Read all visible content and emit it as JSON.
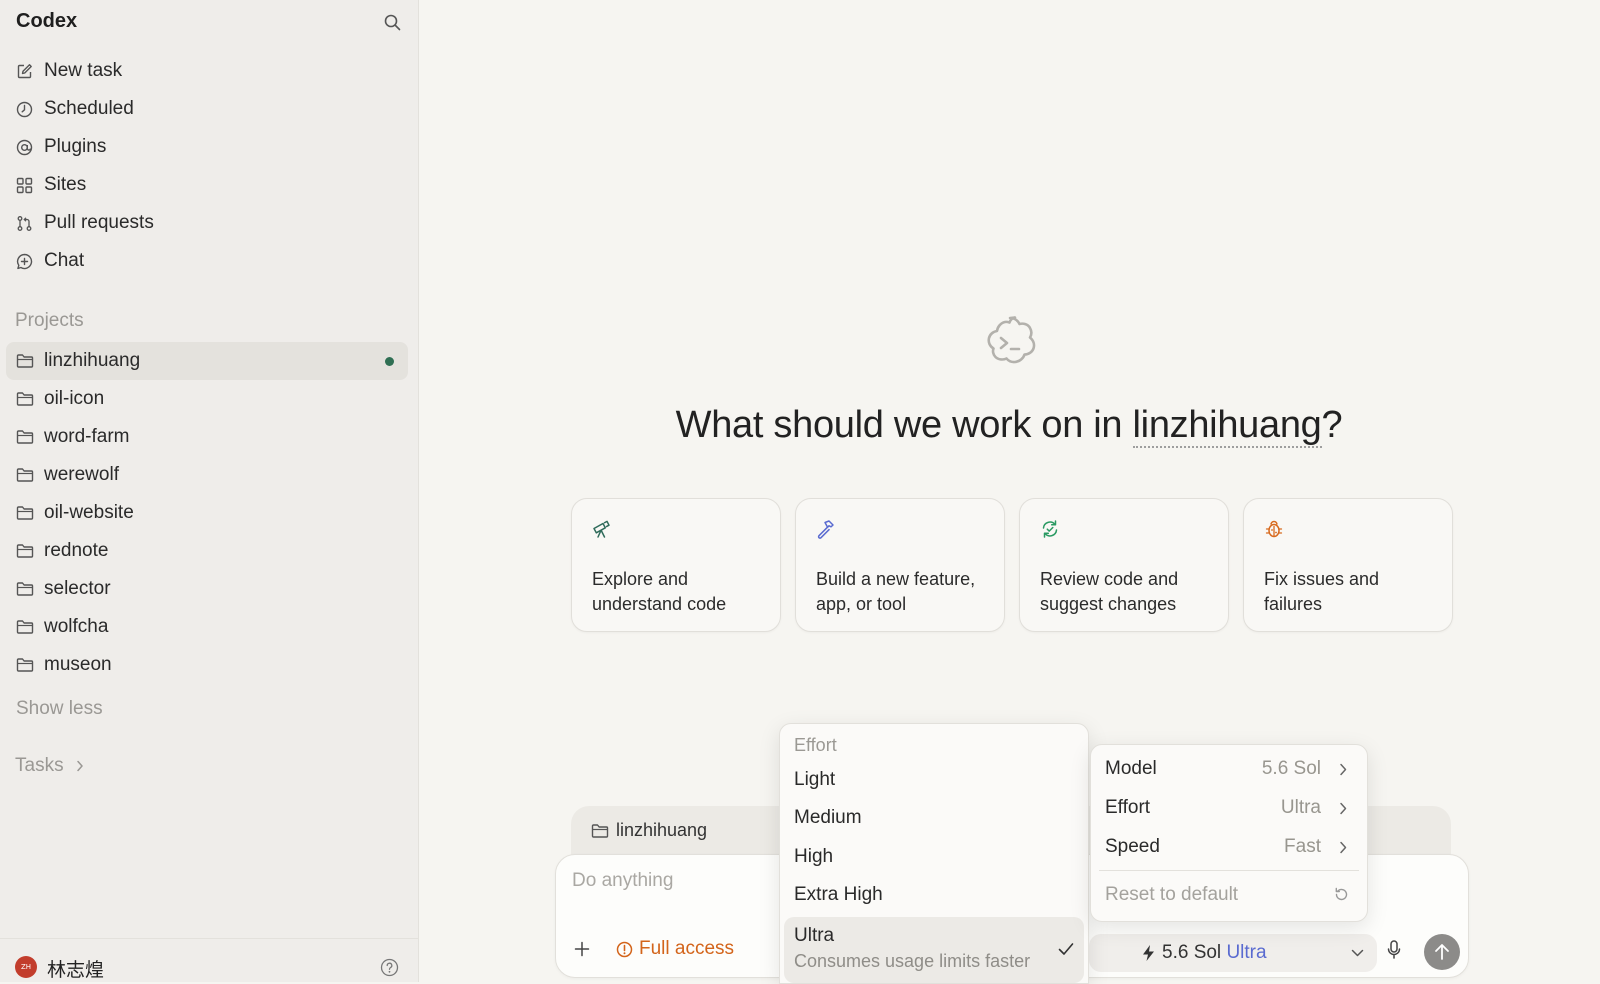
{
  "app": {
    "title": "Codex"
  },
  "sidebar": {
    "nav": [
      {
        "label": "New task",
        "icon": "edit-icon"
      },
      {
        "label": "Scheduled",
        "icon": "clock-icon"
      },
      {
        "label": "Plugins",
        "icon": "at-icon"
      },
      {
        "label": "Sites",
        "icon": "grid-icon"
      },
      {
        "label": "Pull requests",
        "icon": "pull-request-icon"
      },
      {
        "label": "Chat",
        "icon": "chat-plus-icon"
      }
    ],
    "projects_label": "Projects",
    "projects": [
      {
        "label": "linzhihuang",
        "active": true
      },
      {
        "label": "oil-icon"
      },
      {
        "label": "word-farm"
      },
      {
        "label": "werewolf"
      },
      {
        "label": "oil-website"
      },
      {
        "label": "rednote"
      },
      {
        "label": "selector"
      },
      {
        "label": "wolfcha"
      },
      {
        "label": "museon"
      }
    ],
    "show_less": "Show less",
    "tasks_label": "Tasks",
    "user": {
      "name": "林志煌",
      "initials": "ZH",
      "avatar_color": "#c23d2c"
    }
  },
  "main": {
    "title_prefix": "What should we work on in ",
    "title_project": "linzhihuang",
    "title_suffix": "?",
    "cards": [
      {
        "text": "Explore and understand code",
        "icon": "telescope-icon",
        "color": "#2f6b5a"
      },
      {
        "text": "Build a new feature, app, or tool",
        "icon": "hammer-icon",
        "color": "#5a6bd0"
      },
      {
        "text": "Review code and suggest changes",
        "icon": "review-refresh-icon",
        "color": "#2a9a62"
      },
      {
        "text": "Fix issues and failures",
        "icon": "bug-icon",
        "color": "#d86a1e"
      }
    ]
  },
  "composer": {
    "project": "linzhihuang",
    "placeholder": "Do anything",
    "access_label": "Full access",
    "model_label": "5.6 Sol",
    "effort_label": "Ultra"
  },
  "effort_menu": {
    "header": "Effort",
    "options": [
      "Light",
      "Medium",
      "High",
      "Extra High"
    ],
    "selected": {
      "label": "Ultra",
      "description": "Consumes usage limits faster"
    }
  },
  "settings_menu": {
    "rows": [
      {
        "key": "Model",
        "value": "5.6 Sol"
      },
      {
        "key": "Effort",
        "value": "Ultra"
      },
      {
        "key": "Speed",
        "value": "Fast"
      }
    ],
    "reset_label": "Reset to default"
  },
  "colors": {
    "accent_orange": "#d3641a",
    "accent_blue": "#5a6bd0",
    "active_dot": "#2f6f53"
  }
}
